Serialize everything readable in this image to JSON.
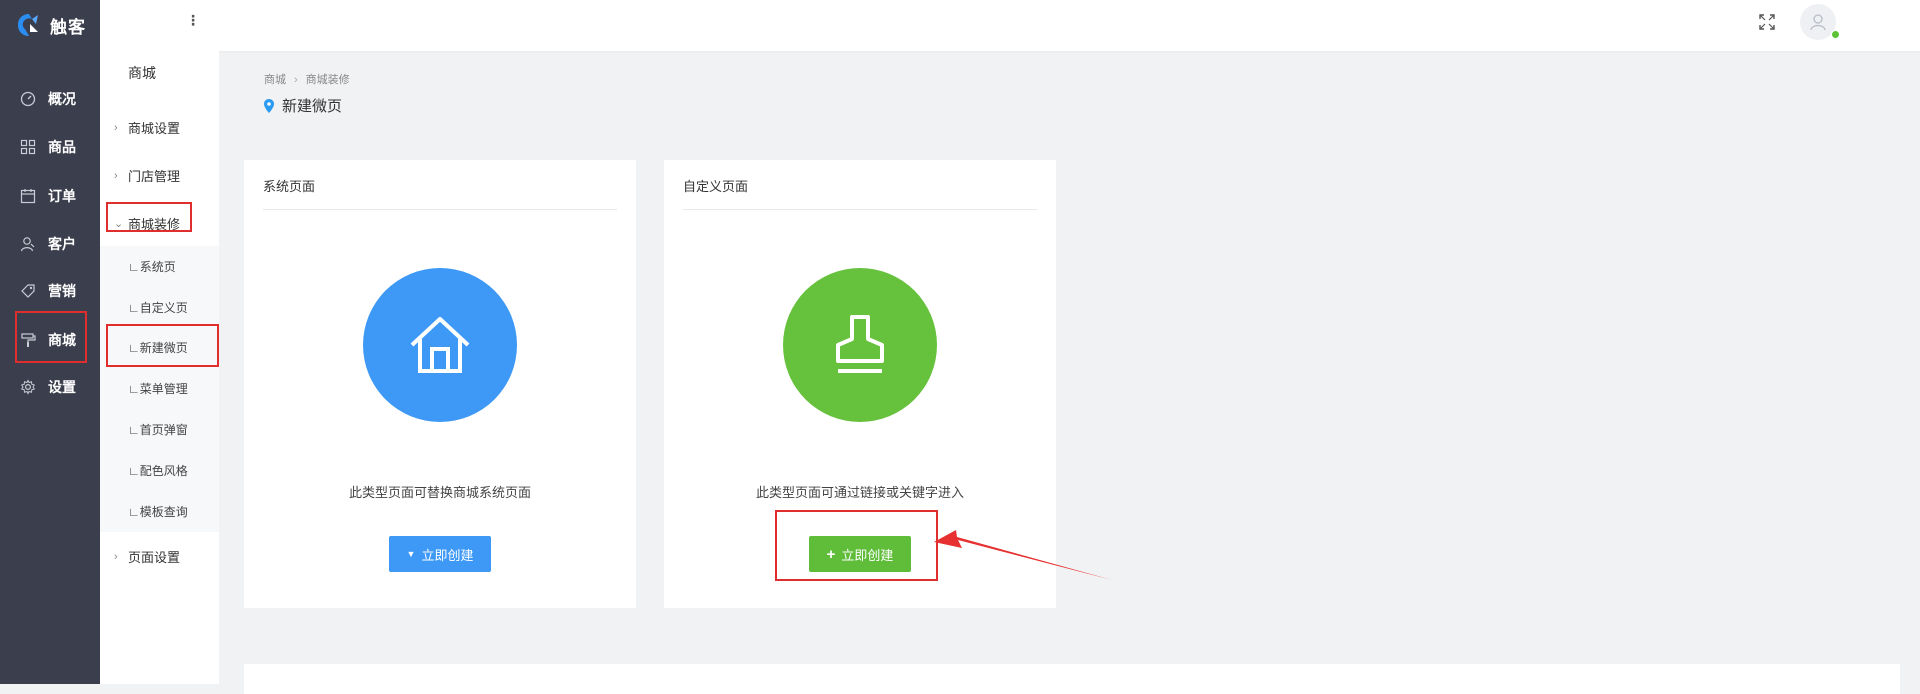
{
  "brand": {
    "name": "触客"
  },
  "rail": [
    {
      "label": "概况",
      "icon": "dashboard-icon"
    },
    {
      "label": "商品",
      "icon": "grid-icon"
    },
    {
      "label": "订单",
      "icon": "calendar-icon"
    },
    {
      "label": "客户",
      "icon": "user-icon"
    },
    {
      "label": "营销",
      "icon": "tag-icon"
    },
    {
      "label": "商城",
      "icon": "paint-roller-icon"
    },
    {
      "label": "设置",
      "icon": "gear-icon"
    }
  ],
  "submenu": {
    "title": "商城",
    "items": [
      {
        "label": "商城设置"
      },
      {
        "label": "门店管理"
      },
      {
        "label": "商城装修"
      },
      {
        "label": "页面设置"
      }
    ],
    "subitems": [
      {
        "label": "∟系统页"
      },
      {
        "label": "∟自定义页"
      },
      {
        "label": "∟新建微页"
      },
      {
        "label": "∟菜单管理"
      },
      {
        "label": "∟首页弹窗"
      },
      {
        "label": "∟配色风格"
      },
      {
        "label": "∟模板查询"
      }
    ]
  },
  "breadcrumb": {
    "root": "商城",
    "current": "商城装修"
  },
  "page_title": "新建微页",
  "cards": [
    {
      "head": "系统页面",
      "desc": "此类型页面可替换商城系统页面",
      "button": "立即创建",
      "color": "#3d99f5"
    },
    {
      "head": "自定义页面",
      "desc": "此类型页面可通过链接或关键字进入",
      "button": "立即创建",
      "color": "#66c13c"
    }
  ],
  "colors": {
    "rail_bg": "#3b3e4d",
    "accent_blue": "#3d99f5",
    "accent_green": "#5fbd3a",
    "annotation_red": "#e02d2d"
  }
}
